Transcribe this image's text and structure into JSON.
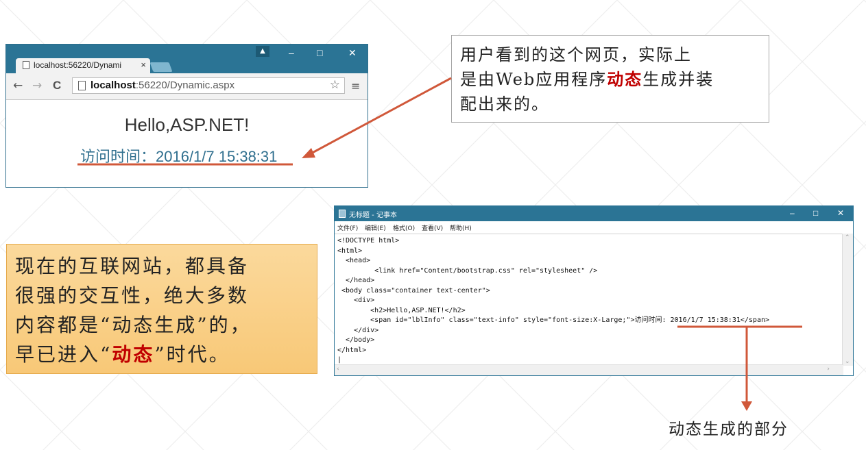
{
  "browser": {
    "tab_label": "localhost:56220/Dynami",
    "tab_close": "×",
    "win_min": "–",
    "win_max": "□",
    "win_close": "✕",
    "back": "←",
    "forward": "→",
    "reload": "C",
    "url_host": "localhost",
    "url_rest": ":56220/Dynamic.aspx",
    "star": "☆",
    "menu": "≡",
    "user_icon": "person-icon",
    "page_heading": "Hello,ASP.NET!",
    "info_text": "访问时间：2016/1/7 15:38:31",
    "info_color": "#31708f"
  },
  "callout_top": {
    "line1": "用户看到的这个网页，实际上",
    "line2_a": "是由Web应用程序",
    "line2_em": "动态",
    "line2_b": "生成并装",
    "line3": "配出来的。"
  },
  "callout_left": {
    "line1": "现在的互联网站，都具备",
    "line2": "很强的交互性，绝大多数",
    "line3": "内容都是“动态生成”的，",
    "line4_a": "早已进入“",
    "line4_em": "动态",
    "line4_b": "”时代。"
  },
  "notepad": {
    "title": "无标题 - 记事本",
    "win_min": "–",
    "win_max": "□",
    "win_close": "✕",
    "menus": [
      "文件(F)",
      "编辑(E)",
      "格式(O)",
      "查看(V)",
      "帮助(H)"
    ],
    "code": "<!DOCTYPE html>\n<html>\n  <head>\n         <link href=\"Content/bootstrap.css\" rel=\"stylesheet\" />\n  </head>\n <body class=\"container text-center\">\n    <div>\n        <h2>Hello,ASP.NET!</h2>\n        <span id=\"lblInfo\" class=\"text-info\" style=\"font-size:X-Large;\">访问时间: 2016/1/7 15:38:31</span>\n    </div>\n  </body>\n</html>\n|"
  },
  "caption": "动态生成的部分",
  "colors": {
    "accent_red": "#c00000",
    "arrow": "#d0583a",
    "titlebar": "#2b7495",
    "orange_box": "#f8c877"
  }
}
